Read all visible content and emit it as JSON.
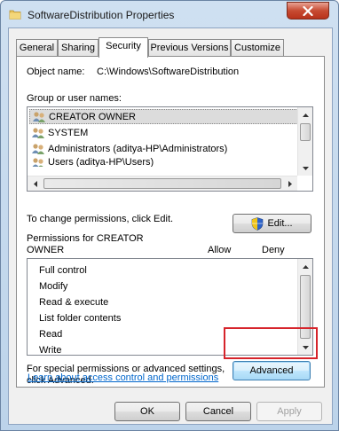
{
  "window": {
    "title": "SoftwareDistribution Properties"
  },
  "tabs": [
    {
      "label": "General"
    },
    {
      "label": "Sharing"
    },
    {
      "label": "Security"
    },
    {
      "label": "Previous Versions"
    },
    {
      "label": "Customize"
    }
  ],
  "security": {
    "object_name_label": "Object name:",
    "object_name_value": "C:\\Windows\\SoftwareDistribution",
    "group_label": "Group or user names:",
    "users": [
      {
        "name": "CREATOR OWNER",
        "selected": true
      },
      {
        "name": "SYSTEM",
        "selected": false
      },
      {
        "name": "Administrators (aditya-HP\\Administrators)",
        "selected": false
      },
      {
        "name": "Users (aditya-HP\\Users)",
        "selected": false
      }
    ],
    "change_text": "To change permissions, click Edit.",
    "edit_label": "Edit...",
    "permissions_for_line1": "Permissions for CREATOR",
    "permissions_for_line2": "OWNER",
    "allow_header": "Allow",
    "deny_header": "Deny",
    "permissions": [
      "Full control",
      "Modify",
      "Read & execute",
      "List folder contents",
      "Read",
      "Write"
    ],
    "special_text_line1": "For special permissions or advanced settings,",
    "special_text_line2": "click Advanced.",
    "advanced_label": "Advanced",
    "learn_link": "Learn about access control and permissions"
  },
  "buttons": {
    "ok": "OK",
    "cancel": "Cancel",
    "apply": "Apply"
  },
  "colors": {
    "highlight_box": "#d6242b",
    "link": "#0066cc"
  }
}
